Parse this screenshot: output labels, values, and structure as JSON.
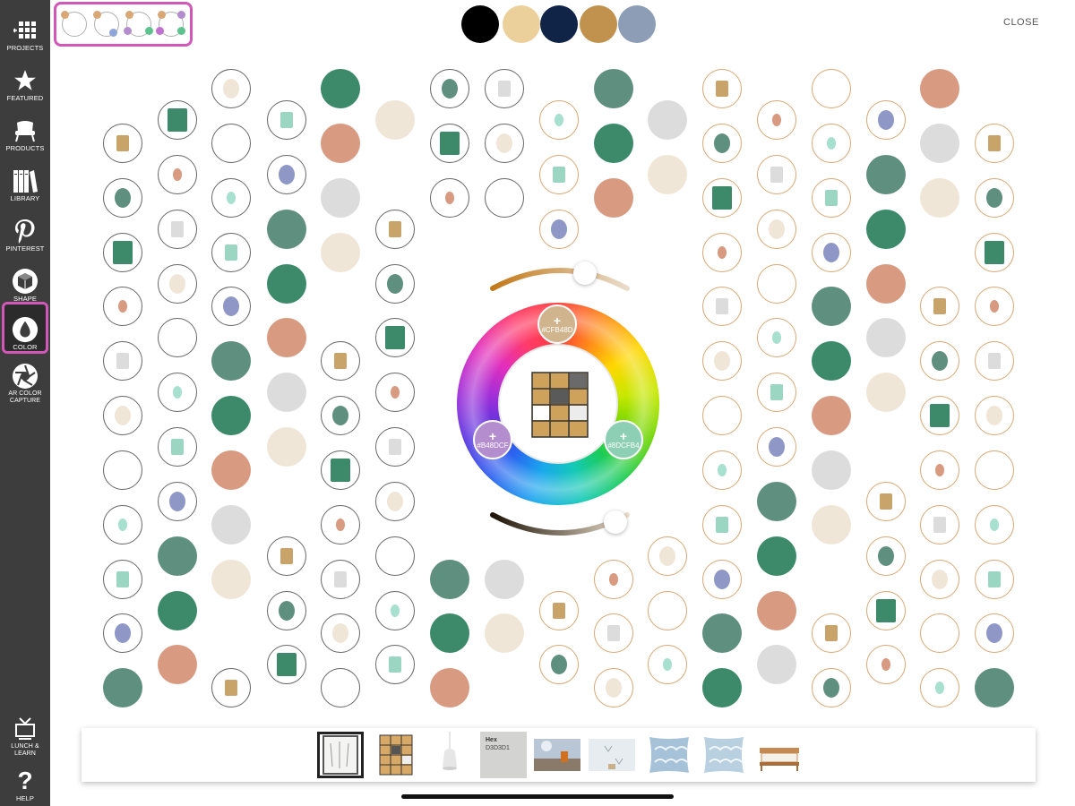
{
  "sidebar": {
    "items": [
      {
        "label": "PROJECTS",
        "icon": "projects-grid-icon"
      },
      {
        "label": "FEATURED",
        "icon": "star-icon"
      },
      {
        "label": "PRODUCTS",
        "icon": "chair-icon"
      },
      {
        "label": "LIBRARY",
        "icon": "books-icon"
      },
      {
        "label": "PINTEREST",
        "icon": "pinterest-icon"
      },
      {
        "label": "SHAPE",
        "icon": "cube-icon"
      },
      {
        "label": "COLOR",
        "icon": "droplet-icon",
        "active": true
      },
      {
        "label": "AR COLOR CAPTURE",
        "icon": "aperture-icon"
      },
      {
        "label": "LUNCH & LEARN",
        "icon": "presentation-icon"
      },
      {
        "label": "HELP",
        "icon": "question-icon"
      }
    ]
  },
  "palette_modes": [
    {
      "name": "monochrome",
      "dots": [
        "#d9a774"
      ]
    },
    {
      "name": "complementary",
      "dots": [
        "#d9a774",
        "#8fa6d8"
      ]
    },
    {
      "name": "triad",
      "dots": [
        "#d9a774",
        "#b48dcf",
        "#8dcfb4"
      ]
    },
    {
      "name": "tetrad",
      "dots": [
        "#d9a774",
        "#b48dcf",
        "#8dcfb4",
        "#7fb3e6"
      ]
    }
  ],
  "top_swatches": [
    "#000000",
    "#ecd09c",
    "#0f2447",
    "#c1924d",
    "#8c9db5"
  ],
  "close_label": "CLOSE",
  "wheel": {
    "handles": [
      {
        "label": "#CFB48D",
        "color": "#cfb48d",
        "plus": "+"
      },
      {
        "label": "#B48DCF",
        "color": "#b48dcf",
        "plus": "+"
      },
      {
        "label": "#8DCFB4",
        "color": "#8dcfb4",
        "plus": "+"
      }
    ]
  },
  "tray": {
    "hex_title": "Hex",
    "hex_value": "D3D3D1"
  },
  "colors": {
    "accent": "#d158b9",
    "sidebar_bg": "#3d3d3d",
    "ring_tan": "#d9a774"
  }
}
